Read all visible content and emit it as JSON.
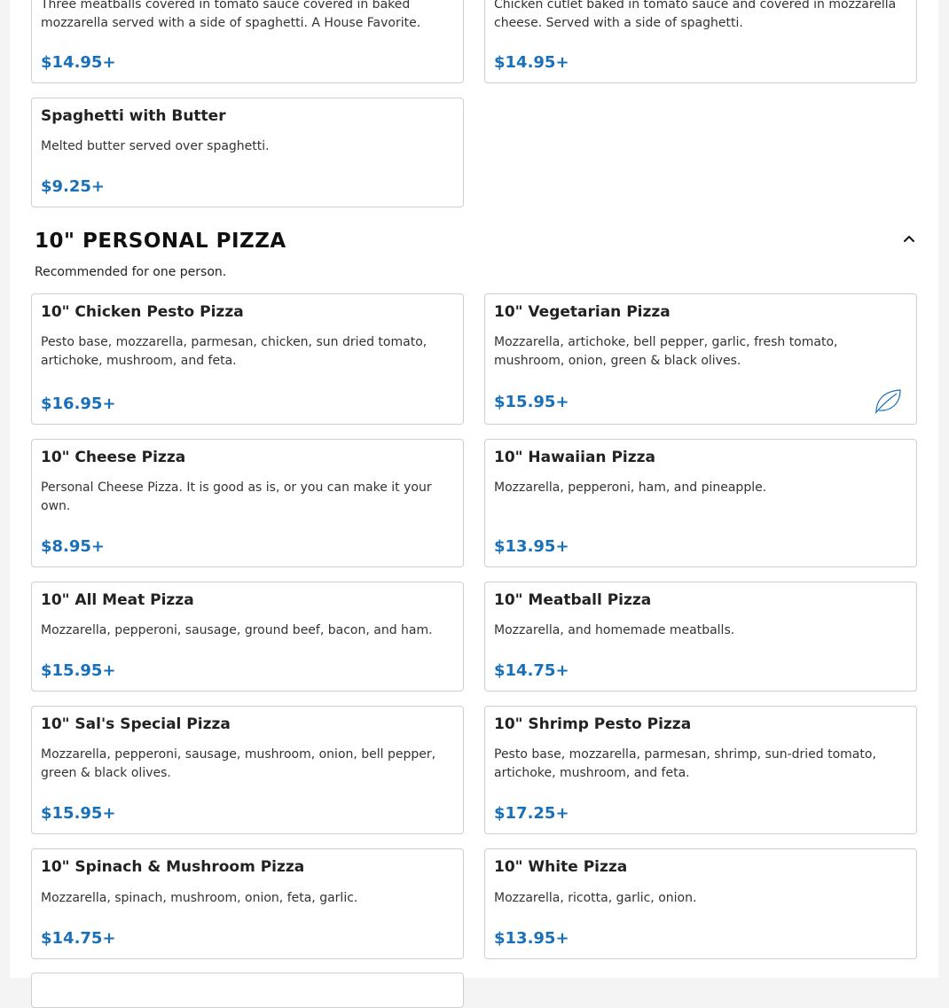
{
  "previous_section": {
    "items": [
      {
        "description": "Three meatballs covered in tomato sauce covered in baked mozzarella served with a side of spaghetti. A House Favorite.",
        "price": "$14.95+"
      },
      {
        "description": "Chicken cutlet baked in tomato sauce and covered in mozzarella cheese. Served with a side of spaghetti.",
        "price": "$14.95+"
      },
      {
        "name": "Spaghetti with Butter",
        "description": "Melted butter served over spaghetti.",
        "price": "$9.25+"
      }
    ]
  },
  "section": {
    "title": "10\" PERSONAL PIZZA",
    "subtitle": "Recommended for one person.",
    "collapse_icon": "chevron-up-icon",
    "items": [
      {
        "name": "10\" Chicken Pesto Pizza",
        "description": "Pesto base, mozzarella, parmesan, chicken, sun dried tomato, artichoke, mushroom, and feta.",
        "price": "$16.95+"
      },
      {
        "name": "10\" Vegetarian Pizza",
        "description": "Mozzarella, artichoke, bell pepper, garlic, fresh tomato, mushroom, onion, green & black olives.",
        "price": "$15.95+",
        "icon": "leaf-icon"
      },
      {
        "name": "10\" Cheese Pizza",
        "description": "Personal Cheese Pizza. It is good as is, or you can make it your own.",
        "price": "$8.95+"
      },
      {
        "name": "10\" Hawaiian Pizza",
        "description": "Mozzarella, pepperoni, ham, and pineapple.",
        "price": "$13.95+"
      },
      {
        "name": "10\" All Meat Pizza",
        "description": "Mozzarella, pepperoni, sausage, ground beef, bacon, and ham.",
        "price": "$15.95+"
      },
      {
        "name": "10\" Meatball Pizza",
        "description": "Mozzarella, and homemade meatballs.",
        "price": "$14.75+"
      },
      {
        "name": "10\" Sal's Special Pizza",
        "description": "Mozzarella, pepperoni, sausage, mushroom, onion, bell pepper, green & black olives.",
        "price": "$15.95+"
      },
      {
        "name": "10\" Shrimp Pesto Pizza",
        "description": "Pesto base, mozzarella, parmesan, shrimp, sun-dried tomato, artichoke, mushroom, and feta.",
        "price": "$17.25+"
      },
      {
        "name": "10\" Spinach & Mushroom Pizza",
        "description": "Mozzarella, spinach, mushroom, onion, feta, garlic.",
        "price": "$14.75+"
      },
      {
        "name": "10\" White Pizza",
        "description": "Mozzarella, ricotta, garlic, onion.",
        "price": "$13.95+"
      }
    ]
  },
  "colors": {
    "price": "#1a70b8",
    "border": "#cfcfcf",
    "leaf": "#1a70b8"
  }
}
